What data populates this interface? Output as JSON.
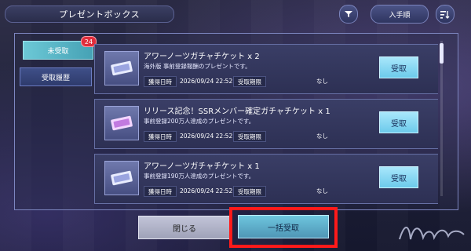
{
  "header": {
    "title": "プレゼントボックス",
    "sort_label": "入手順"
  },
  "tabs": {
    "unclaimed": "未受取",
    "history": "受取履歴",
    "unclaimed_count": "24"
  },
  "items": [
    {
      "title": "アワーノーツガチャチケット x 2",
      "description": "海外版 事前登録報酬のプレゼントです。",
      "obtained_label": "獲得日時",
      "obtained_value": "2026/09/24 22:52",
      "deadline_label": "受取期限",
      "deadline_value": "なし",
      "claim_label": "受取"
    },
    {
      "title": "リリース記念！SSRメンバー確定ガチャチケット x 1",
      "description": "事前登録200万人達成のプレゼントです。",
      "obtained_label": "獲得日時",
      "obtained_value": "2026/09/24 22:52",
      "deadline_label": "受取期限",
      "deadline_value": "なし",
      "claim_label": "受取"
    },
    {
      "title": "アワーノーツガチャチケット x 1",
      "description": "事前登録190万人達成のプレゼントです。",
      "obtained_label": "獲得日時",
      "obtained_value": "2026/09/24 22:52",
      "deadline_label": "受取期限",
      "deadline_value": "なし",
      "claim_label": "受取"
    }
  ],
  "footer": {
    "close_label": "閉じる",
    "claim_all_label": "一括受取"
  },
  "icons": {
    "filter": "filter-icon",
    "sort": "sort-icon",
    "ticket": "ticket-icon"
  },
  "colors": {
    "accent": "#6ccaeb",
    "highlight": "#ff1a1a",
    "badge": "#e02e3c"
  }
}
